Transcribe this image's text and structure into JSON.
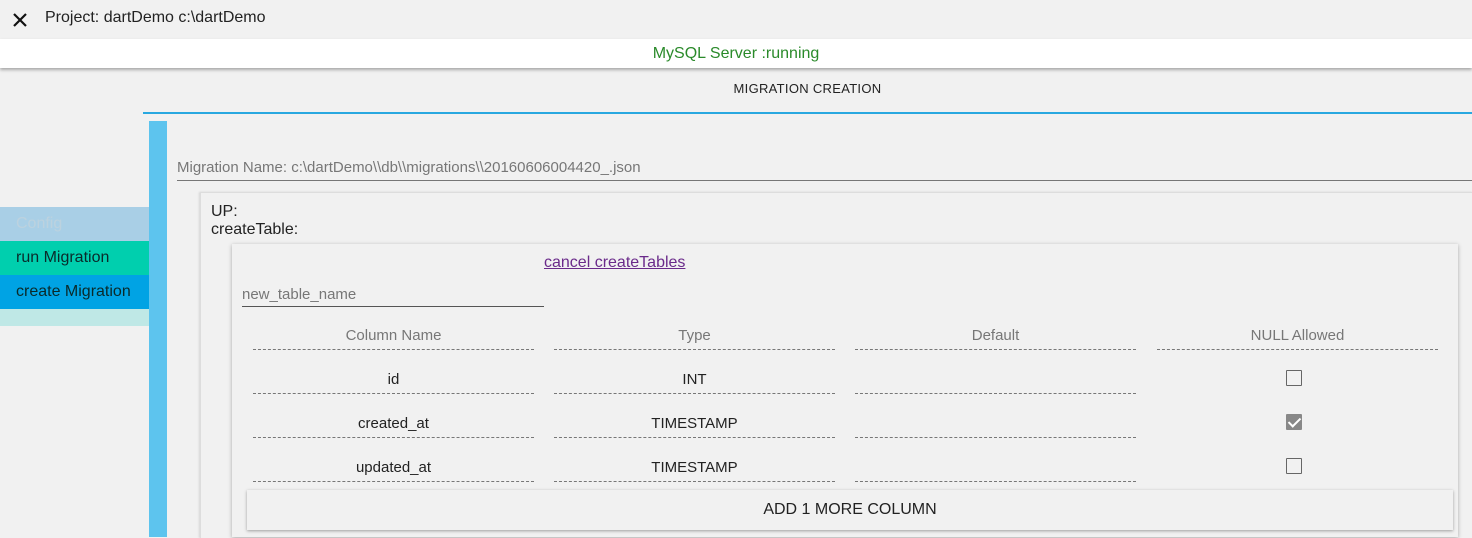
{
  "window": {
    "title": "Project: dartDemo c:\\dartDemo",
    "close_icon": "close-icon"
  },
  "status": {
    "text": "MySQL Server :running",
    "color": "#2a8a2a"
  },
  "tab": {
    "label": "MIGRATION CREATION",
    "accent": "#29a8e0"
  },
  "menu": {
    "items": [
      {
        "label": "Config",
        "color": "#a9cfe6"
      },
      {
        "label": "run Migration",
        "color": "#00cfae"
      },
      {
        "label": "create Migration",
        "color": "#00a3e4"
      },
      {
        "label": "",
        "color": "#bfe8e6"
      }
    ]
  },
  "migration": {
    "name_text": "Migration Name: c:\\dartDemo\\\\db\\\\migrations\\\\20160606004420_.json"
  },
  "up": {
    "label": "UP:",
    "create_label": "createTable:"
  },
  "create_table": {
    "cancel_link": "cancel createTables",
    "table_name_placeholder": "new_table_name",
    "headers": [
      "Column Name",
      "Type",
      "Default",
      "NULL Allowed"
    ],
    "rows": [
      {
        "name": "id",
        "type": "INT",
        "default": "",
        "null_allowed": false
      },
      {
        "name": "created_at",
        "type": "TIMESTAMP",
        "default": "",
        "null_allowed": true
      },
      {
        "name": "updated_at",
        "type": "TIMESTAMP",
        "default": "",
        "null_allowed": false
      }
    ],
    "add_button": "ADD 1 MORE COLUMN"
  }
}
